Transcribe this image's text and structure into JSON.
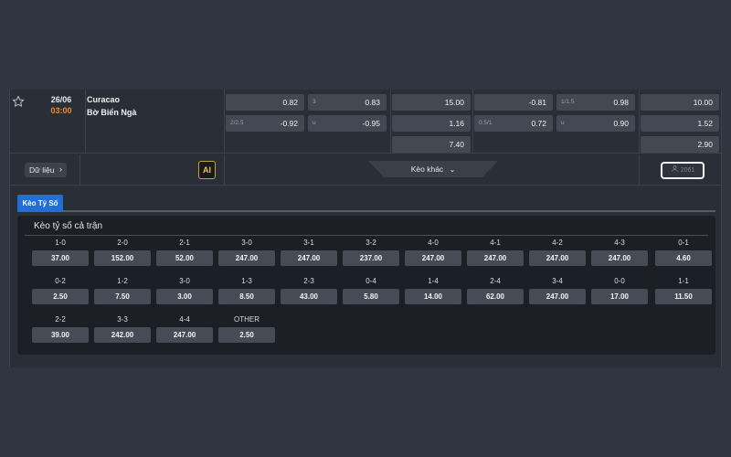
{
  "match": {
    "date": "26/06",
    "time": "03:00",
    "home_team": "Curacao",
    "away_team": "Bờ Biển Ngà"
  },
  "odds": {
    "col1": [
      {
        "label": "",
        "value": "0.82"
      },
      {
        "label": "2/2.5",
        "value": "-0.92"
      }
    ],
    "col2": [
      {
        "label": "3",
        "value": "0.83"
      },
      {
        "label": "u",
        "value": "-0.95"
      }
    ],
    "col3": [
      "15.00",
      "1.16",
      "7.40"
    ],
    "col4": [
      {
        "label": "",
        "value": "-0.81"
      },
      {
        "label": "0.5/1",
        "value": "0.72"
      }
    ],
    "col5": [
      {
        "label": "1/1.5",
        "value": "0.98"
      },
      {
        "label": "u",
        "value": "0.90"
      }
    ],
    "col6": [
      "10.00",
      "1.52",
      "2.90"
    ]
  },
  "actions": {
    "data_label": "Dữ liệu",
    "ai_label": "AI",
    "more_label": "Kèo khác",
    "user_count": "2061"
  },
  "tab_label": "Kèo Tỷ Số",
  "score_section": {
    "title": "Kèo tỷ số cả trận",
    "rows": [
      [
        {
          "score": "1-0",
          "odd": "37.00"
        },
        {
          "score": "2-0",
          "odd": "152.00"
        },
        {
          "score": "2-1",
          "odd": "52.00"
        },
        {
          "score": "3-0",
          "odd": "247.00"
        },
        {
          "score": "3-1",
          "odd": "247.00"
        },
        {
          "score": "3-2",
          "odd": "237.00"
        },
        {
          "score": "4-0",
          "odd": "247.00"
        },
        {
          "score": "4-1",
          "odd": "247.00"
        },
        {
          "score": "4-2",
          "odd": "247.00"
        },
        {
          "score": "4-3",
          "odd": "247.00"
        },
        {
          "score": "0-1",
          "odd": "4.60"
        }
      ],
      [
        {
          "score": "0-2",
          "odd": "2.50"
        },
        {
          "score": "1-2",
          "odd": "7.50"
        },
        {
          "score": "3-0",
          "odd": "3.00"
        },
        {
          "score": "1-3",
          "odd": "8.50"
        },
        {
          "score": "2-3",
          "odd": "43.00"
        },
        {
          "score": "0-4",
          "odd": "5.80"
        },
        {
          "score": "1-4",
          "odd": "14.00"
        },
        {
          "score": "2-4",
          "odd": "62.00"
        },
        {
          "score": "3-4",
          "odd": "247.00"
        },
        {
          "score": "0-0",
          "odd": "17.00"
        },
        {
          "score": "1-1",
          "odd": "11.50"
        }
      ],
      [
        {
          "score": "2-2",
          "odd": "39.00"
        },
        {
          "score": "3-3",
          "odd": "242.00"
        },
        {
          "score": "4-4",
          "odd": "247.00"
        },
        {
          "score": "OTHER",
          "odd": "2.50"
        }
      ]
    ]
  }
}
